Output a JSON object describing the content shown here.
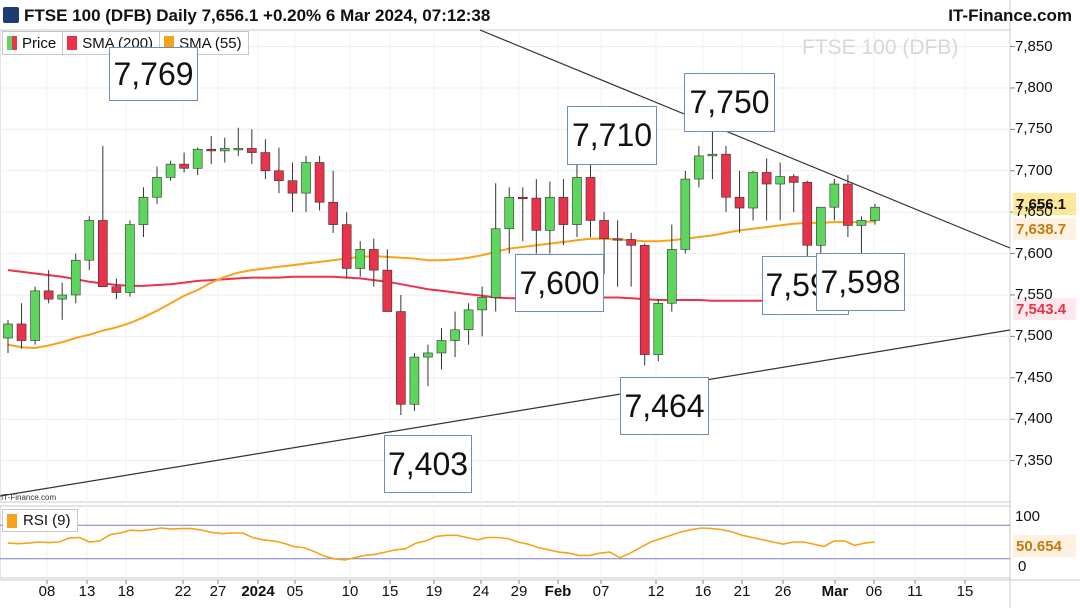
{
  "header": {
    "title": "FTSE 100 (DFB) Daily 7,656.1 +0.20% 6 Mar 2024, 07:12:38",
    "brand": "IT-Finance.com"
  },
  "watermark": "FTSE 100 (DFB)",
  "side_credit": "IT-Finance.com",
  "legend": {
    "price": "Price",
    "sma200": "SMA (200)",
    "sma55": "SMA (55)",
    "rsi": "RSI (9)"
  },
  "colors": {
    "up": "#5cd65c",
    "down": "#e8334a",
    "sma200": "#e8334a",
    "sma55": "#f7a21b",
    "rsi": "#f7a21b",
    "trendline": "#333333",
    "callout_border": "#6c8ebf"
  },
  "badges": {
    "price": "7,656.1",
    "sma55": "7,638.7",
    "sma200": "7,543.4",
    "rsi": "50.654"
  },
  "callouts": [
    "7,769",
    "7,710",
    "7,750",
    "7,600",
    "7,596",
    "7,598",
    "7,464",
    "7,403"
  ],
  "chart_data": {
    "type": "candlestick",
    "title": "FTSE 100 (DFB) Daily",
    "ylim": [
      7300,
      7870
    ],
    "y_ticks": [
      "7,850",
      "7,800",
      "7,750",
      "7,700",
      "7,650",
      "7,600",
      "7,550",
      "7,500",
      "7,450",
      "7,400",
      "7,350"
    ],
    "x_ticks": [
      {
        "label": "08",
        "bold": false
      },
      {
        "label": "13",
        "bold": false
      },
      {
        "label": "18",
        "bold": false
      },
      {
        "label": "22",
        "bold": false
      },
      {
        "label": "27",
        "bold": false
      },
      {
        "label": "2024",
        "bold": true
      },
      {
        "label": "05",
        "bold": false
      },
      {
        "label": "10",
        "bold": false
      },
      {
        "label": "15",
        "bold": false
      },
      {
        "label": "19",
        "bold": false
      },
      {
        "label": "24",
        "bold": false
      },
      {
        "label": "29",
        "bold": false
      },
      {
        "label": "Feb",
        "bold": true
      },
      {
        "label": "07",
        "bold": false
      },
      {
        "label": "12",
        "bold": false
      },
      {
        "label": "16",
        "bold": false
      },
      {
        "label": "21",
        "bold": false
      },
      {
        "label": "26",
        "bold": false
      },
      {
        "label": "Mar",
        "bold": true
      },
      {
        "label": "06",
        "bold": false
      },
      {
        "label": "11",
        "bold": false
      },
      {
        "label": "15",
        "bold": false
      }
    ],
    "candles": [
      [
        7498,
        7520,
        7480,
        7515
      ],
      [
        7515,
        7540,
        7485,
        7495
      ],
      [
        7495,
        7560,
        7490,
        7555
      ],
      [
        7555,
        7580,
        7540,
        7545
      ],
      [
        7545,
        7565,
        7520,
        7550
      ],
      [
        7550,
        7600,
        7540,
        7592
      ],
      [
        7592,
        7645,
        7580,
        7640
      ],
      [
        7640,
        7730,
        7560,
        7560
      ],
      [
        7560,
        7570,
        7545,
        7553
      ],
      [
        7553,
        7640,
        7548,
        7635
      ],
      [
        7635,
        7680,
        7620,
        7668
      ],
      [
        7668,
        7705,
        7660,
        7692
      ],
      [
        7692,
        7712,
        7688,
        7708
      ],
      [
        7708,
        7722,
        7698,
        7703
      ],
      [
        7703,
        7728,
        7695,
        7726
      ],
      [
        7726,
        7742,
        7708,
        7724
      ],
      [
        7724,
        7740,
        7710,
        7727
      ],
      [
        7727,
        7752,
        7718,
        7727
      ],
      [
        7727,
        7750,
        7708,
        7722
      ],
      [
        7722,
        7738,
        7690,
        7700
      ],
      [
        7700,
        7728,
        7673,
        7688
      ],
      [
        7688,
        7710,
        7650,
        7673
      ],
      [
        7673,
        7718,
        7650,
        7710
      ],
      [
        7710,
        7718,
        7652,
        7662
      ],
      [
        7662,
        7700,
        7625,
        7635
      ],
      [
        7635,
        7650,
        7570,
        7582
      ],
      [
        7582,
        7615,
        7572,
        7605
      ],
      [
        7605,
        7618,
        7560,
        7580
      ],
      [
        7580,
        7605,
        7530,
        7530
      ],
      [
        7530,
        7550,
        7405,
        7418
      ],
      [
        7418,
        7480,
        7410,
        7475
      ],
      [
        7475,
        7490,
        7440,
        7480
      ],
      [
        7480,
        7510,
        7460,
        7495
      ],
      [
        7495,
        7530,
        7475,
        7508
      ],
      [
        7508,
        7540,
        7490,
        7532
      ],
      [
        7532,
        7560,
        7500,
        7547
      ],
      [
        7547,
        7685,
        7530,
        7630
      ],
      [
        7630,
        7680,
        7600,
        7668
      ],
      [
        7668,
        7680,
        7615,
        7667
      ],
      [
        7667,
        7690,
        7600,
        7628
      ],
      [
        7628,
        7687,
        7600,
        7668
      ],
      [
        7668,
        7690,
        7610,
        7635
      ],
      [
        7635,
        7710,
        7620,
        7692
      ],
      [
        7692,
        7710,
        7620,
        7640
      ],
      [
        7640,
        7650,
        7575,
        7618
      ],
      [
        7618,
        7640,
        7560,
        7617
      ],
      [
        7617,
        7625,
        7560,
        7610
      ],
      [
        7610,
        7612,
        7465,
        7478
      ],
      [
        7478,
        7545,
        7470,
        7540
      ],
      [
        7540,
        7635,
        7530,
        7605
      ],
      [
        7605,
        7700,
        7600,
        7690
      ],
      [
        7690,
        7730,
        7680,
        7718
      ],
      [
        7718,
        7750,
        7690,
        7720
      ],
      [
        7720,
        7730,
        7650,
        7668
      ],
      [
        7668,
        7700,
        7625,
        7655
      ],
      [
        7655,
        7700,
        7640,
        7698
      ],
      [
        7698,
        7715,
        7640,
        7684
      ],
      [
        7684,
        7710,
        7640,
        7693
      ],
      [
        7693,
        7696,
        7650,
        7686
      ],
      [
        7686,
        7688,
        7596,
        7610
      ],
      [
        7610,
        7650,
        7600,
        7656
      ],
      [
        7656,
        7690,
        7640,
        7684
      ],
      [
        7684,
        7695,
        7620,
        7634
      ],
      [
        7634,
        7645,
        7598,
        7640
      ],
      [
        7640,
        7660,
        7635,
        7656
      ]
    ],
    "sma55": [
      7490,
      7487,
      7486,
      7489,
      7493,
      7498,
      7502,
      7507,
      7511,
      7516,
      7523,
      7531,
      7540,
      7549,
      7556,
      7565,
      7572,
      7577,
      7580,
      7582,
      7584,
      7586,
      7588,
      7590,
      7592,
      7594,
      7596,
      7597,
      7596,
      7595,
      7594,
      7592,
      7592,
      7593,
      7595,
      7598,
      7602,
      7606,
      7608,
      7610,
      7612,
      7614,
      7616,
      7618,
      7618,
      7617,
      7616,
      7615,
      7615,
      7616,
      7618,
      7620,
      7622,
      7625,
      7628,
      7630,
      7632,
      7634,
      7636,
      7637,
      7637,
      7638,
      7638,
      7638,
      7639
    ],
    "sma200": [
      7580,
      7578,
      7576,
      7574,
      7572,
      7569,
      7566,
      7564,
      7562,
      7561,
      7561,
      7562,
      7563,
      7565,
      7567,
      7568,
      7569,
      7570,
      7571,
      7571,
      7571,
      7572,
      7572,
      7572,
      7572,
      7571,
      7570,
      7568,
      7566,
      7563,
      7560,
      7557,
      7555,
      7553,
      7551,
      7549,
      7547,
      7546,
      7546,
      7546,
      7546,
      7546,
      7546,
      7547,
      7547,
      7547,
      7546,
      7545,
      7544,
      7544,
      7544,
      7544,
      7543,
      7543,
      7543,
      7543,
      7543,
      7543,
      7543,
      7543,
      7543,
      7543,
      7543,
      7543,
      7543
    ],
    "rsi_ylim": [
      0,
      100
    ],
    "rsi_ticks": [
      "100",
      "0"
    ],
    "rsi_levels": [
      80,
      20
    ],
    "rsi": [
      48,
      47,
      48,
      50,
      49,
      50,
      57,
      58,
      50,
      52,
      63,
      66,
      71,
      70,
      72,
      75,
      73,
      74,
      74,
      71,
      67,
      65,
      66,
      66,
      58,
      54,
      52,
      48,
      42,
      40,
      33,
      25,
      20,
      18,
      22,
      26,
      28,
      32,
      36,
      38,
      48,
      52,
      60,
      62,
      62,
      58,
      54,
      58,
      58,
      56,
      50,
      46,
      40,
      36,
      32,
      30,
      26,
      26,
      30,
      32,
      22,
      30,
      40,
      50,
      56,
      62,
      68,
      72,
      75,
      74,
      72,
      68,
      62,
      58,
      54,
      50,
      46,
      50,
      50,
      46,
      42,
      52,
      52,
      44,
      48,
      50
    ]
  }
}
